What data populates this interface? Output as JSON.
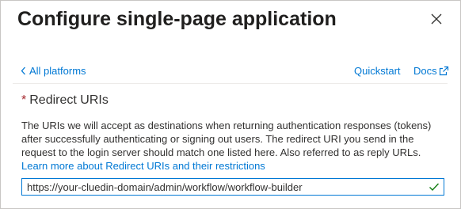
{
  "panel": {
    "title": "Configure single-page application",
    "close_icon": "close-icon"
  },
  "nav": {
    "back_label": "All platforms",
    "back_icon": "chevron-left-icon",
    "quickstart_label": "Quickstart",
    "docs_label": "Docs",
    "docs_icon": "external-link-icon"
  },
  "redirect": {
    "required_marker": "*",
    "label": "Redirect URIs",
    "description": "The URIs we will accept as destinations when returning authentication responses (tokens) after successfully authenticating or signing out users. The redirect URI you send in the request to the login server should match one listed here. Also referred to as reply URLs. ",
    "learn_more_link": "Learn more about Redirect URIs and their restrictions",
    "uri_value": "https://your-cluedin-domain/admin/workflow/workflow-builder",
    "valid_icon": "checkmark-icon"
  },
  "colors": {
    "accent": "#0078d4",
    "required": "#a4262c",
    "valid": "#107c10",
    "text": "#323130"
  }
}
